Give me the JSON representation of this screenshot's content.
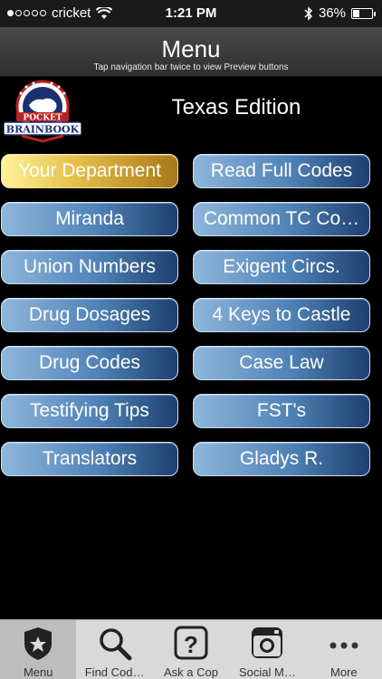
{
  "status_bar": {
    "carrier": "cricket",
    "time": "1:21 PM",
    "battery_percent": "36%",
    "battery_level": 0.36
  },
  "nav": {
    "title": "Menu",
    "subtitle": "Tap navigation bar twice to view Preview buttons"
  },
  "logo": {
    "top_text": "POCKET",
    "bottom_text": "BRAINBOOK"
  },
  "edition_title": "Texas Edition",
  "menu": {
    "left": [
      "Your Department",
      "Miranda",
      "Union Numbers",
      "Drug Dosages",
      "Drug Codes",
      "Testifying Tips",
      "Translators"
    ],
    "right": [
      "Read Full Codes",
      "Common TC Co…",
      "Exigent Circs.",
      "4 Keys to Castle",
      "Case Law",
      "FST's",
      "Gladys R."
    ]
  },
  "tabs": [
    {
      "label": "Menu",
      "icon": "badge-icon"
    },
    {
      "label": "Find Cod…",
      "icon": "search-icon"
    },
    {
      "label": "Ask a Cop",
      "icon": "question-icon"
    },
    {
      "label": "Social M…",
      "icon": "instagram-icon"
    },
    {
      "label": "More",
      "icon": "more-icon"
    }
  ],
  "colors": {
    "button_blue": "#4f82b6",
    "button_gold": "#e6c14a",
    "background": "#000000",
    "tab_bar": "#d9d9d9"
  }
}
